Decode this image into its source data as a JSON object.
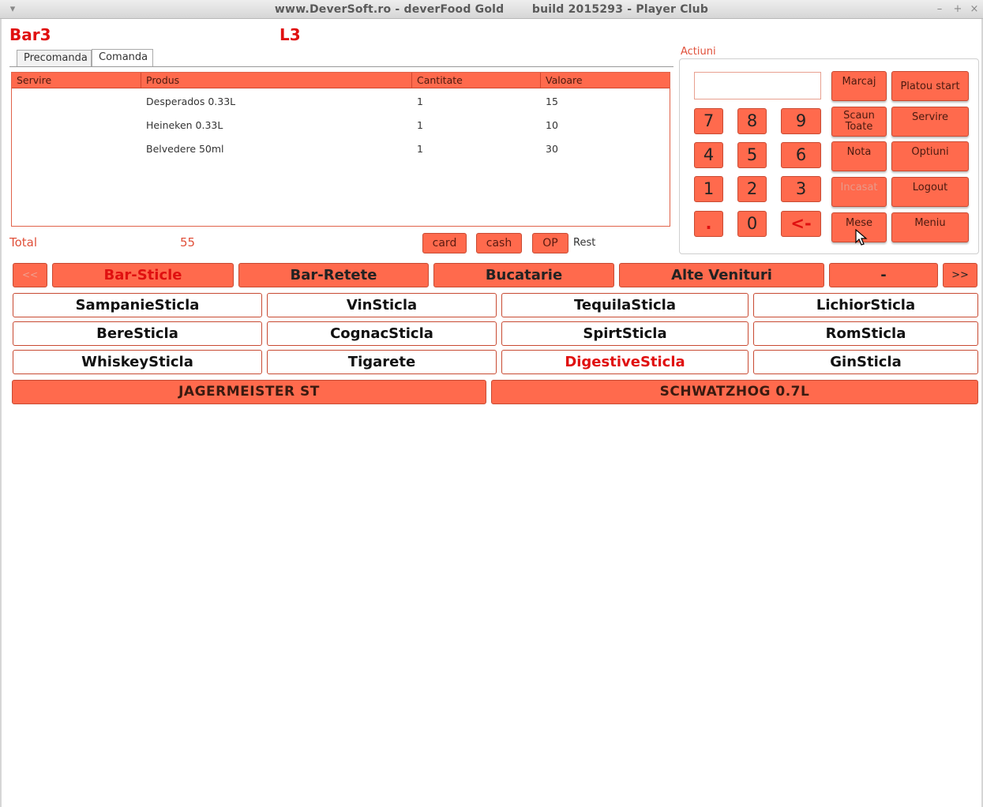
{
  "window": {
    "title": "www.DeverSoft.ro - deverFood Gold       build 2015293 - Player Club",
    "menu_icon": "▾",
    "minimize_icon": "–",
    "maximize_icon": "+",
    "close_icon": "×"
  },
  "header": {
    "location": "Bar3",
    "table": "L3"
  },
  "tabs": [
    {
      "label": "Precomanda"
    },
    {
      "label": "Comanda"
    }
  ],
  "order": {
    "columns": [
      "Servire",
      "Produs",
      "Cantitate",
      "Valoare"
    ],
    "rows": [
      {
        "servire": "",
        "produs": "Desperados 0.33L",
        "cantitate": "1",
        "valoare": "15"
      },
      {
        "servire": "",
        "produs": "Heineken 0.33L",
        "cantitate": "1",
        "valoare": "10"
      },
      {
        "servire": "",
        "produs": "Belvedere 50ml",
        "cantitate": "1",
        "valoare": "30"
      }
    ]
  },
  "totals": {
    "label": "Total",
    "value": "55",
    "card": "card",
    "cash": "cash",
    "op": "OP",
    "rest": "Rest"
  },
  "actions": {
    "title": "Actiuni",
    "input_value": "",
    "keypad": [
      "7",
      "8",
      "9",
      "4",
      "5",
      "6",
      "1",
      "2",
      "3",
      ".",
      "0",
      "<-"
    ],
    "buttons": {
      "marcaj": "Marcaj",
      "platou_start": "Platou start",
      "scaun_toate": "Scaun\nToate",
      "servire": "Servire",
      "nota": "Nota",
      "optiuni": "Optiuni",
      "incasat": "Incasat",
      "logout": "Logout",
      "mese": "Mese",
      "meniu": "Meniu"
    }
  },
  "categories": {
    "prev": "<<",
    "next": ">>",
    "items": [
      "Bar-Sticle",
      "Bar-Retete",
      "Bucatarie",
      "Alte Venituri",
      "-"
    ]
  },
  "subcategories": [
    "SampanieSticla",
    "VinSticla",
    "TequilaSticla",
    "LichiorSticla",
    "BereSticla",
    "CognacSticla",
    "SpirtSticla",
    "RomSticla",
    "WhiskeySticla",
    "Tigarete",
    "DigestiveSticla",
    "GinSticla"
  ],
  "products": [
    "JAGERMEISTER ST",
    "SCHWATZHOG 0.7L"
  ],
  "colors": {
    "accent": "#ff6a4d",
    "accent_border": "#c84a32",
    "highlight_text": "#e01010"
  }
}
